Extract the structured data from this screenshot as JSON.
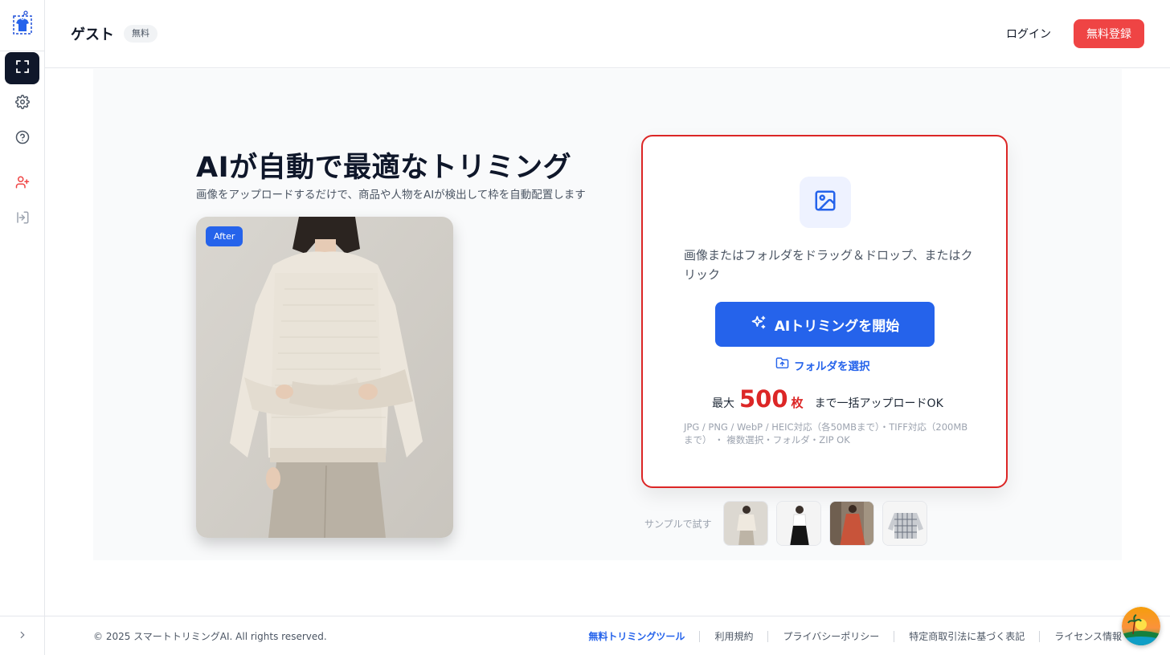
{
  "header": {
    "user_name": "ゲスト",
    "plan_badge": "無料",
    "login_label": "ログイン",
    "signup_label": "無料登録"
  },
  "hero": {
    "title": "AIが自動で最適なトリミング",
    "subtitle": "画像をアップロードするだけで、商品や人物をAIが検出して枠を自動配置します",
    "after_badge": "After"
  },
  "upload": {
    "drop_text": "画像またはフォルダをドラッグ＆ドロップ、またはクリック",
    "start_button": "AIトリミングを開始",
    "folder_link": "フォルダを選択",
    "max_prefix": "最大",
    "max_count": "500",
    "max_unit": "枚",
    "max_suffix": "まで一括アップロードOK",
    "formats": "JPG / PNG / WebP / HEIC対応（各50MBまで）・TIFF対応（200MBまで） ・ 複数選択・フォルダ・ZIP OK"
  },
  "samples": {
    "label": "サンプルで試す"
  },
  "sidebar": {
    "icons": [
      "crop-icon",
      "gear-icon",
      "help-icon",
      "user-plus-icon",
      "logout-icon"
    ]
  },
  "footer": {
    "copyright": "© 2025 スマートトリミングAI. All rights reserved.",
    "links": [
      "無料トリミングツール",
      "利用規約",
      "プライバシーポリシー",
      "特定商取引法に基づく表記",
      "ライセンス情報"
    ]
  },
  "colors": {
    "accent": "#2563eb",
    "danger": "#ef4444",
    "card_border": "#dc2626"
  }
}
